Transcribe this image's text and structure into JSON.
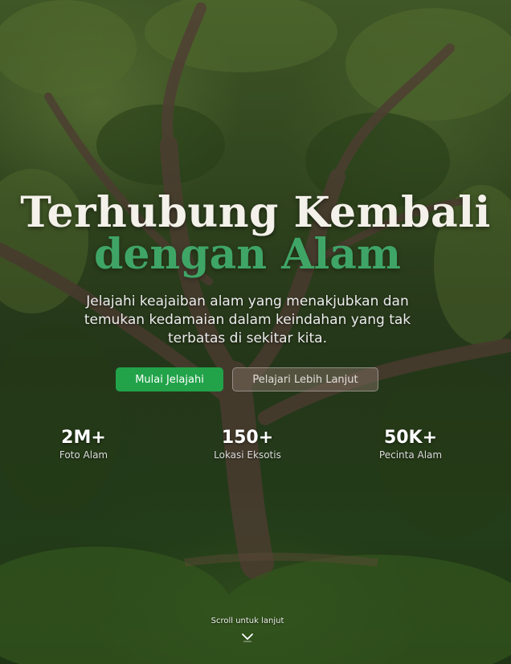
{
  "hero": {
    "title_line1": "Terhubung Kembali",
    "title_line2": "dengan Alam",
    "subtitle": "Jelajahi keajaiban alam yang menakjubkan dan temukan kedamaian dalam keindahan yang tak terbatas di sekitar kita."
  },
  "buttons": {
    "primary_label": "Mulai Jelajahi",
    "secondary_label": "Pelajari Lebih Lanjut"
  },
  "stats": [
    {
      "value": "2M+",
      "label": "Foto Alam"
    },
    {
      "value": "150+",
      "label": "Lokasi Eksotis"
    },
    {
      "value": "50K+",
      "label": "Pecinta Alam"
    }
  ],
  "scroll": {
    "label": "Scroll untuk lanjut",
    "icon": "chevron-down-icon"
  },
  "colors": {
    "accent": "#3fa566",
    "primary_button": "#22a34a"
  }
}
